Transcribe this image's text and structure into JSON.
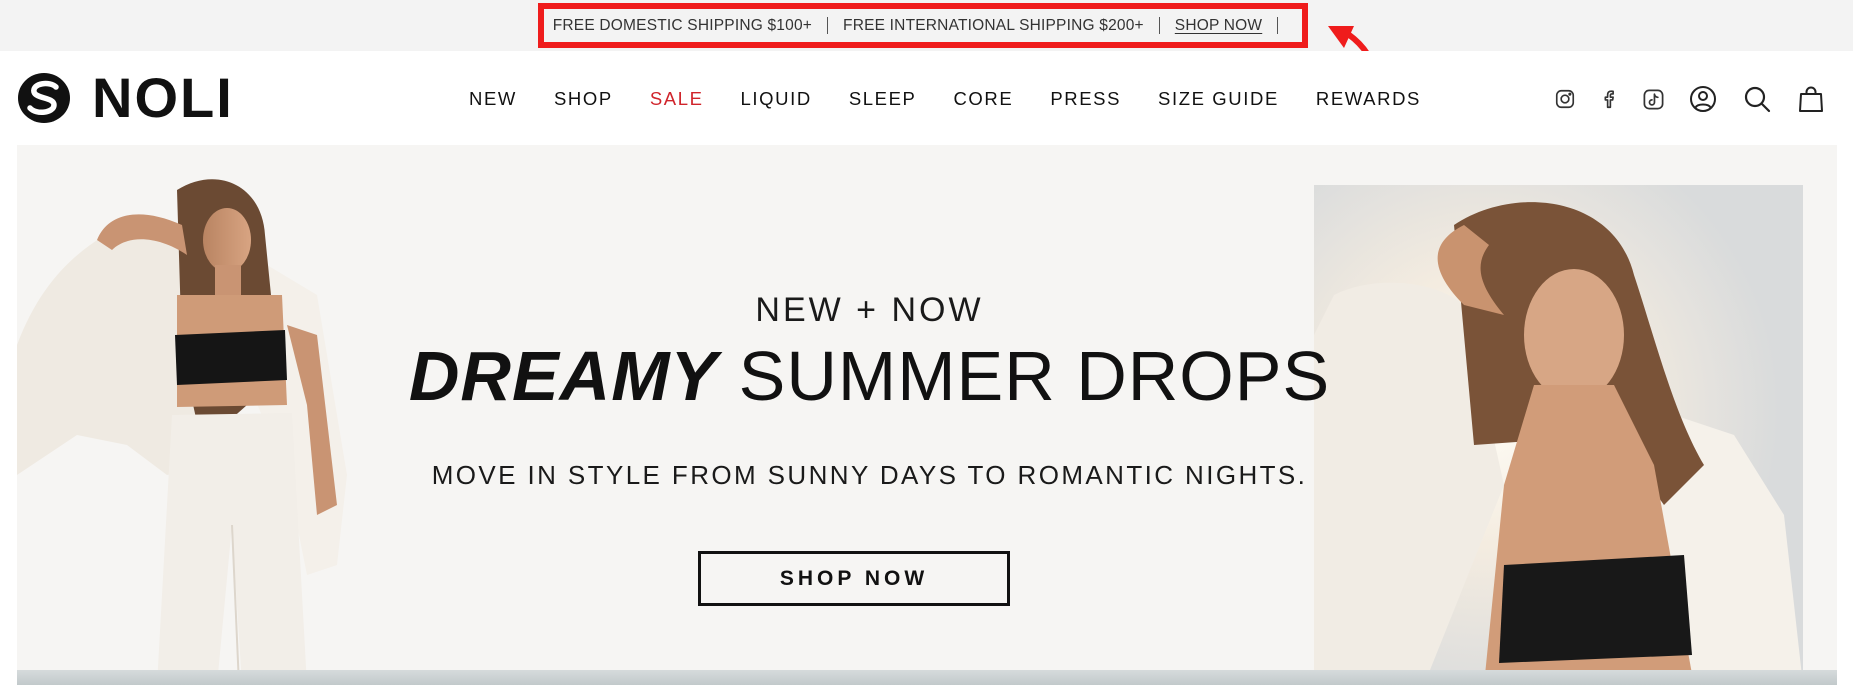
{
  "announcement": {
    "domestic": "FREE DOMESTIC SHIPPING $100+",
    "international": "FREE INTERNATIONAL SHIPPING $200+",
    "link": "SHOP NOW"
  },
  "brand": {
    "name": "NOLI"
  },
  "nav": {
    "items": [
      {
        "label": "NEW"
      },
      {
        "label": "SHOP"
      },
      {
        "label": "SALE"
      },
      {
        "label": "LIQUID"
      },
      {
        "label": "SLEEP"
      },
      {
        "label": "CORE"
      },
      {
        "label": "PRESS"
      },
      {
        "label": "SIZE GUIDE"
      },
      {
        "label": "REWARDS"
      }
    ]
  },
  "icons": [
    "instagram-icon",
    "facebook-icon",
    "tiktok-icon",
    "account-icon",
    "search-icon",
    "cart-icon"
  ],
  "hero": {
    "eyebrow": "NEW + NOW",
    "title_emphasis": "DREAMY",
    "title_rest": "SUMMER DROPS",
    "subtitle": "MOVE IN STYLE FROM SUNNY DAYS TO ROMANTIC NIGHTS.",
    "cta": "SHOP NOW"
  },
  "colors": {
    "sale": "#d0242b",
    "annotation": "#ef1c1c",
    "announcement_bg": "#f3f3f3"
  }
}
